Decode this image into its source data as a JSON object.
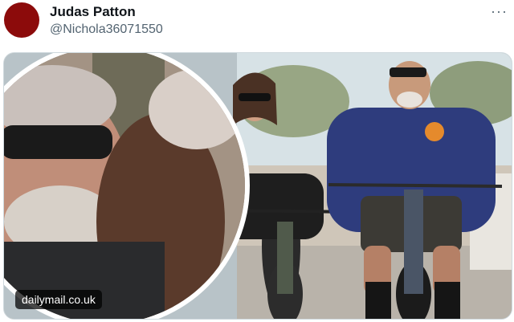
{
  "tweet": {
    "author_name": "Judas Patton",
    "author_handle": "@Nichola36071550",
    "more_icon": "more-horizontal-icon"
  },
  "media": {
    "source_label": "dailymail.co.uk"
  },
  "colors": {
    "avatar": "#8c0b0b",
    "name": "#0f1419",
    "handle": "#536471"
  }
}
